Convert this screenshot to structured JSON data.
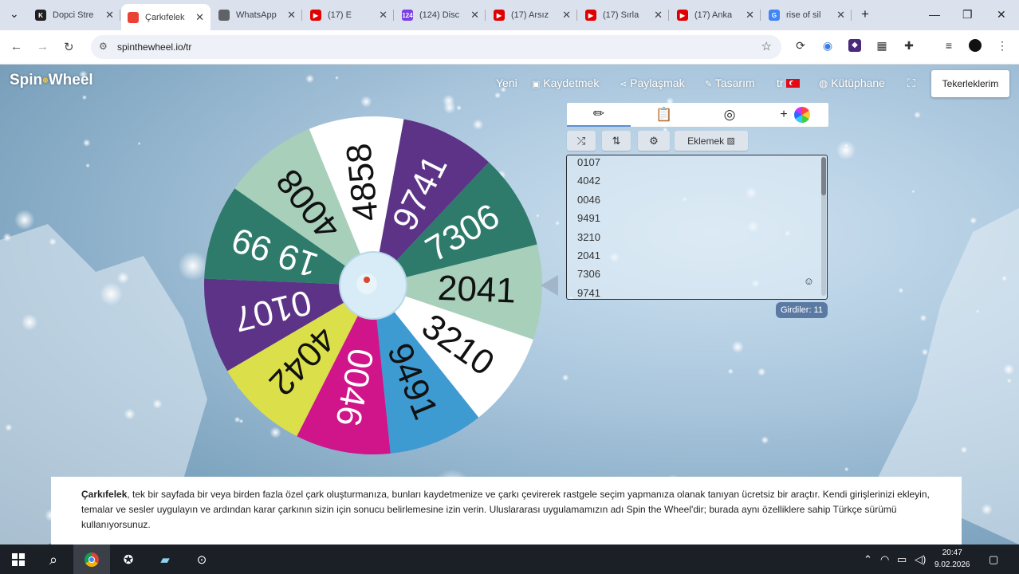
{
  "browser": {
    "tabs": [
      {
        "title": "Dopci Stre",
        "fav_color": "#1f1f1f",
        "fav_text": "K",
        "active": false
      },
      {
        "title": "Çarkıfelek",
        "fav_color": "#ea4335",
        "fav_text": "",
        "active": true
      },
      {
        "title": "WhatsApp",
        "fav_color": "#5f6368",
        "fav_text": "",
        "active": false
      },
      {
        "title": "(17) E",
        "fav_color": "#e00000",
        "fav_text": "▶",
        "active": false
      },
      {
        "title": "(124) Disc",
        "fav_color": "#7b3fe4",
        "fav_text": "124",
        "active": false
      },
      {
        "title": "(17) Arsız",
        "fav_color": "#e00000",
        "fav_text": "▶",
        "active": false
      },
      {
        "title": "(17) Sırla",
        "fav_color": "#e00000",
        "fav_text": "▶",
        "active": false
      },
      {
        "title": "(17) Anka",
        "fav_color": "#e00000",
        "fav_text": "▶",
        "active": false
      },
      {
        "title": "rise of sil",
        "fav_color": "#4285f4",
        "fav_text": "G",
        "active": false
      }
    ],
    "url": "spinthewheel.io/tr"
  },
  "site": {
    "logo_text_1": "Spin",
    "logo_text_2": "Wheel",
    "nav": {
      "new": "Yeni",
      "save": "Kaydetmek",
      "share": "Paylaşmak",
      "design": "Tasarım",
      "lang": "tr",
      "library": "Kütüphane"
    },
    "my_wheels": "Tekerleklerim"
  },
  "wheel": {
    "slices": [
      {
        "label": "2041",
        "color": "#a7cfba",
        "text_color": "#111111"
      },
      {
        "label": "3210",
        "color": "#ffffff",
        "text_color": "#111111"
      },
      {
        "label": "9491",
        "color": "#3e9bd2",
        "text_color": "#111111"
      },
      {
        "label": "0046",
        "color": "#d0148a",
        "text_color": "#ffffff"
      },
      {
        "label": "4042",
        "color": "#dbe04a",
        "text_color": "#111111"
      },
      {
        "label": "0107",
        "color": "#5d3387",
        "text_color": "#ffffff"
      },
      {
        "label": "19 99",
        "color": "#2e7b6c",
        "text_color": "#ffffff"
      },
      {
        "label": "4008",
        "color": "#a7cfba",
        "text_color": "#111111"
      },
      {
        "label": "4858",
        "color": "#ffffff",
        "text_color": "#111111"
      },
      {
        "label": "9741",
        "color": "#5d3387",
        "text_color": "#ffffff"
      },
      {
        "label": "7306",
        "color": "#2e7b6c",
        "text_color": "#ffffff"
      }
    ]
  },
  "editor": {
    "add_image_label": "Eklemek",
    "entries": [
      "0107",
      "4042",
      "0046",
      "9491",
      "3210",
      "2041",
      "7306",
      "9741"
    ],
    "count_label": "Girdiler: 11"
  },
  "description": {
    "bold": "Çarkıfelek",
    "text": ", tek bir sayfada bir veya birden fazla özel çark oluşturmanıza, bunları kaydetmenize ve çarkı çevirerek rastgele seçim yapmanıza olanak tanıyan ücretsiz bir araçtır. Kendi girişlerinizi ekleyin, temalar ve sesler uygulayın ve ardından karar çarkının sizin için sonucu belirlemesine izin verin. Uluslararası uygulamamızın adı Spin the Wheel'dir; burada aynı özelliklere sahip Türkçe sürümü kullanıyorsunuz."
  },
  "taskbar": {
    "time": "20:47",
    "date": "9.02.2026"
  },
  "colors": {
    "accent": "#5a8fd6",
    "badge": "#5b7aa3"
  }
}
